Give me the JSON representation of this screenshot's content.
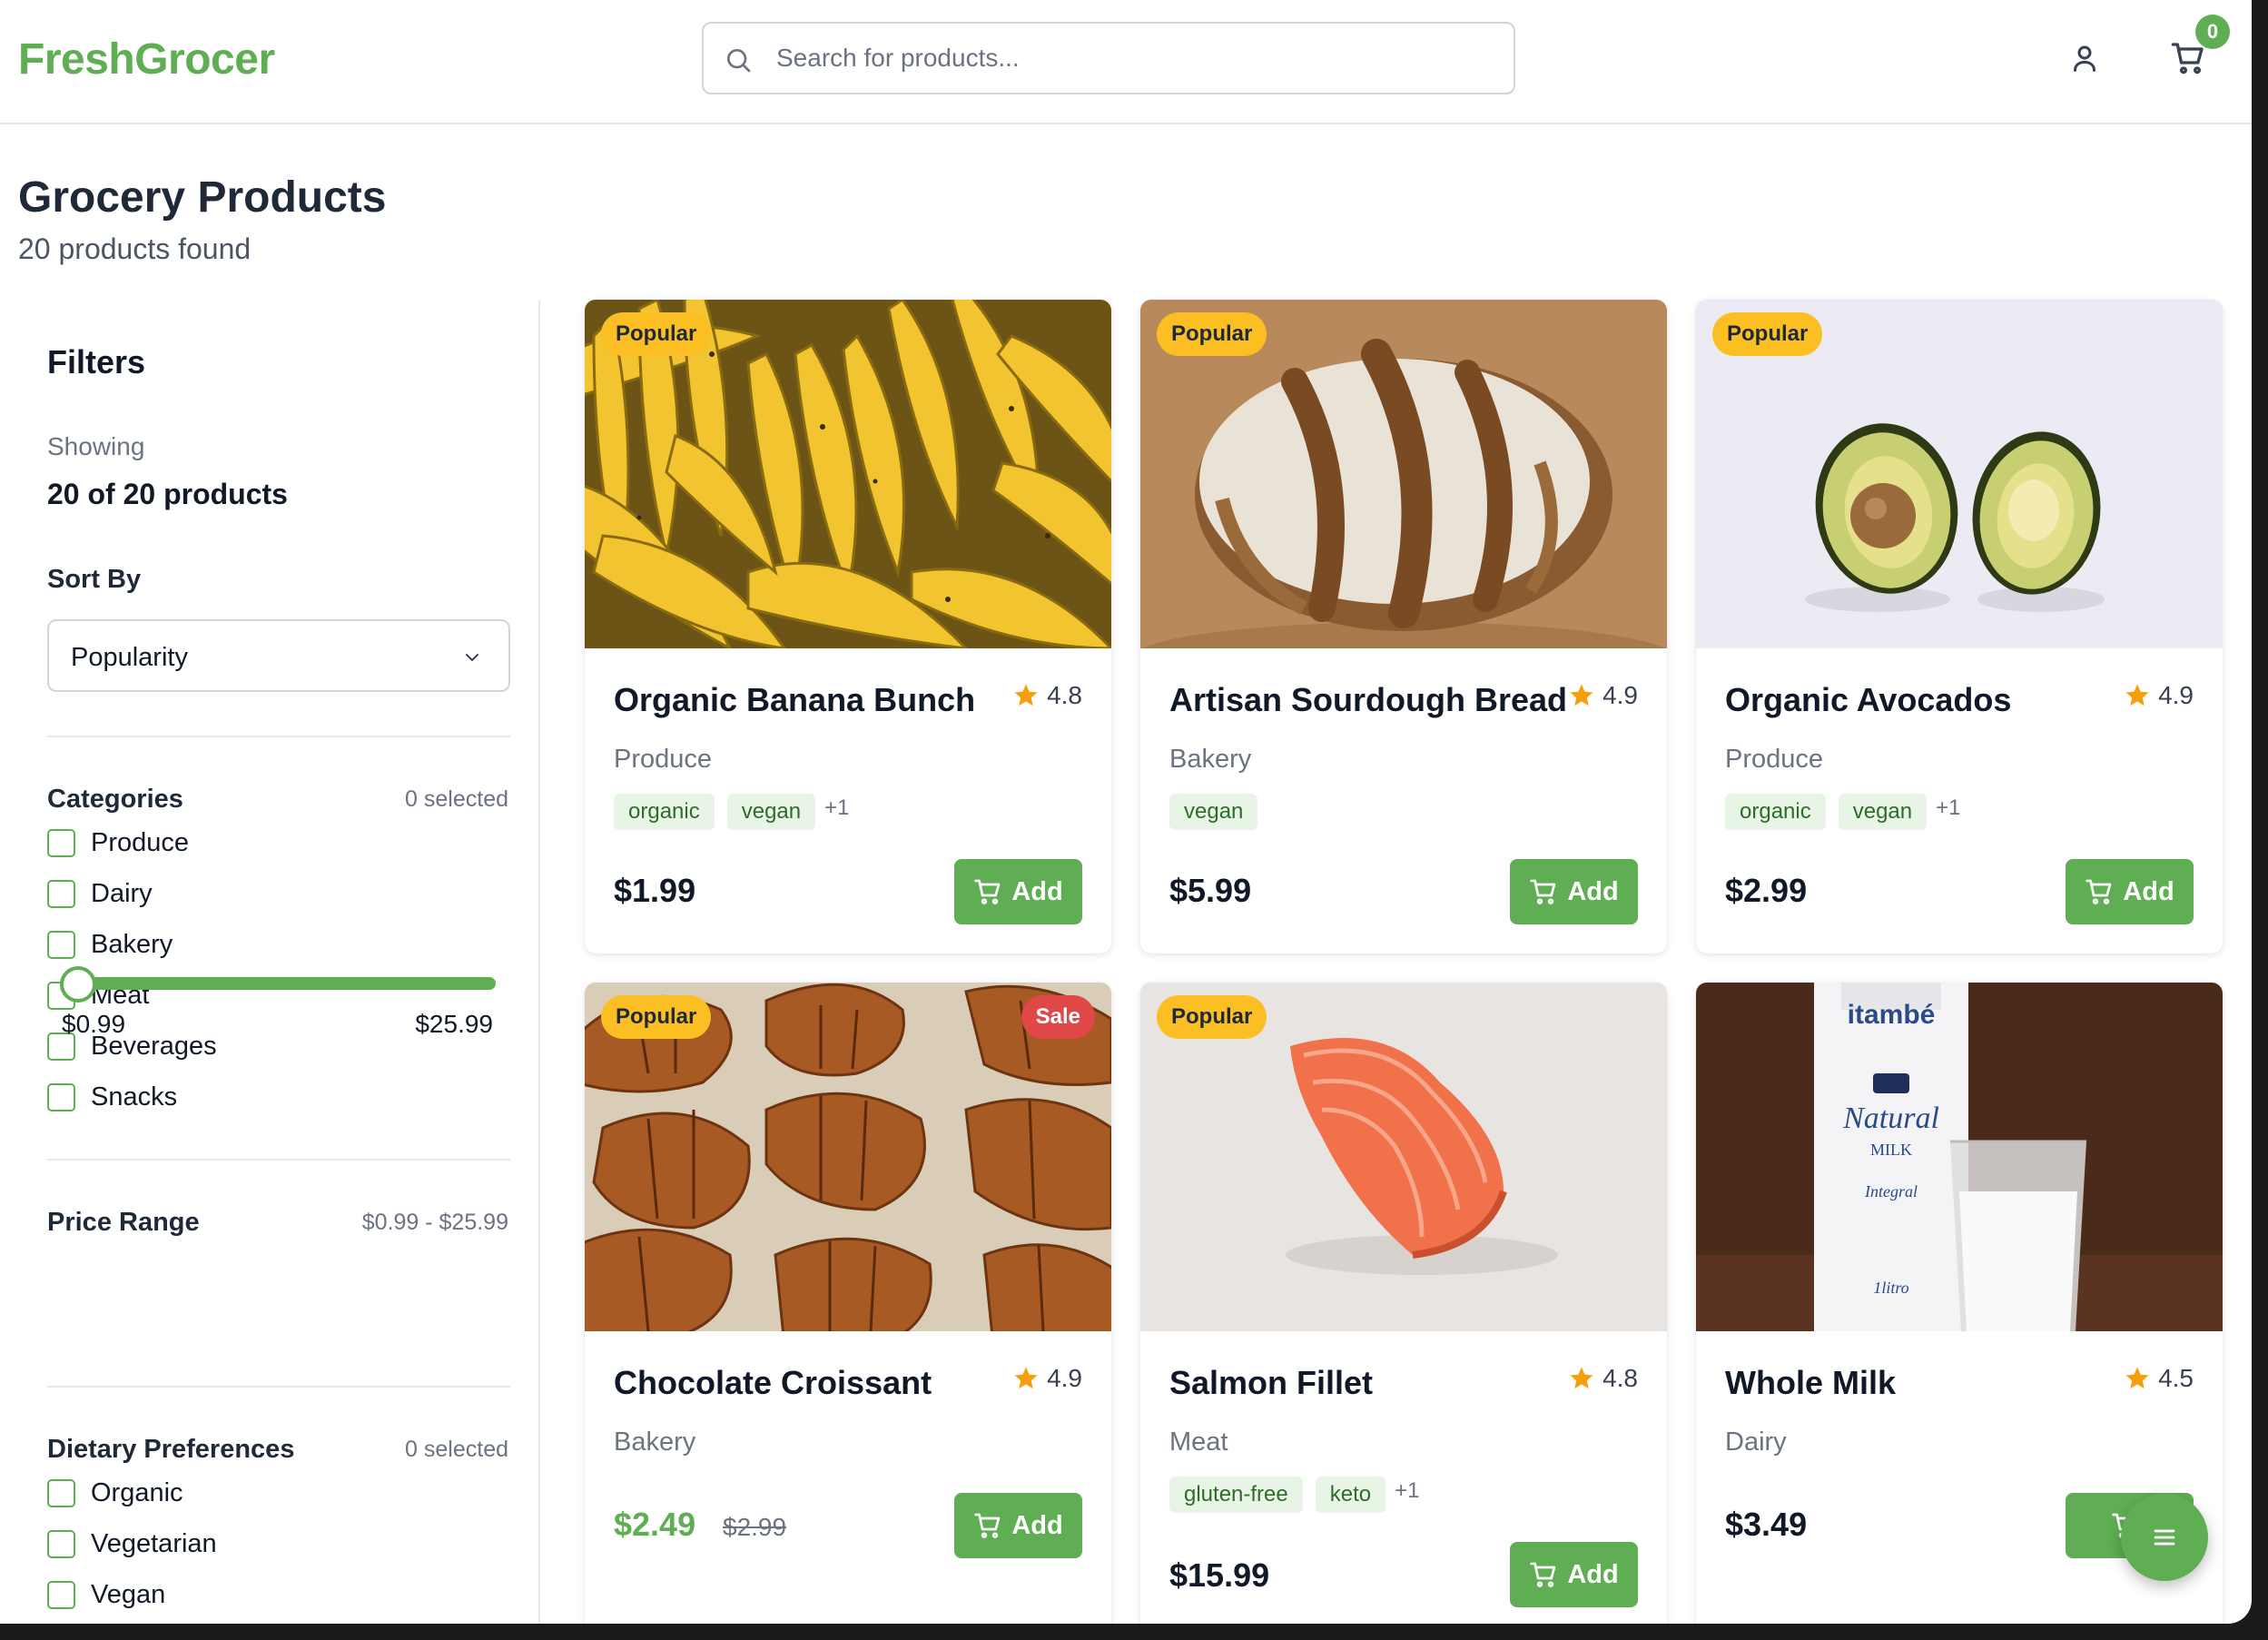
{
  "header": {
    "logo": "FreshGrocer",
    "search_placeholder": "Search for products...",
    "cart_count": "0"
  },
  "page": {
    "title": "Grocery Products",
    "count_text": "20 products found"
  },
  "sidebar": {
    "title": "Filters",
    "showing_label": "Showing",
    "showing_value": "20 of 20 products",
    "sort_label": "Sort By",
    "sort_value": "Popularity",
    "categories_title": "Categories",
    "categories_meta": "0 selected",
    "categories": [
      "Produce",
      "Dairy",
      "Bakery",
      "Meat",
      "Beverages",
      "Snacks"
    ],
    "price_title": "Price Range",
    "price_meta": "$0.99 - $25.99",
    "price_min": "$0.99",
    "price_max": "$25.99",
    "dietary_title": "Dietary Preferences",
    "dietary_meta": "0 selected",
    "dietary": [
      "Organic",
      "Vegetarian",
      "Vegan"
    ]
  },
  "products": [
    {
      "name": "Organic Banana Bunch",
      "rating": "4.8",
      "category": "Produce",
      "tags": [
        "organic",
        "vegan"
      ],
      "more": "+1",
      "price": "$1.99",
      "old_price": "",
      "badges": [
        "Popular"
      ],
      "add_label": "Add",
      "image": "bananas"
    },
    {
      "name": "Artisan Sourdough Bread",
      "rating": "4.9",
      "category": "Bakery",
      "tags": [
        "vegan"
      ],
      "more": "",
      "price": "$5.99",
      "old_price": "",
      "badges": [
        "Popular"
      ],
      "add_label": "Add",
      "image": "bread"
    },
    {
      "name": "Organic Avocados",
      "rating": "4.9",
      "category": "Produce",
      "tags": [
        "organic",
        "vegan"
      ],
      "more": "+1",
      "price": "$2.99",
      "old_price": "",
      "badges": [
        "Popular"
      ],
      "add_label": "Add",
      "image": "avocados"
    },
    {
      "name": "Chocolate Croissant",
      "rating": "4.9",
      "category": "Bakery",
      "tags": [],
      "more": "",
      "price": "$2.49",
      "old_price": "$2.99",
      "badges": [
        "Popular",
        "Sale"
      ],
      "add_label": "Add",
      "image": "croissants"
    },
    {
      "name": "Salmon Fillet",
      "rating": "4.8",
      "category": "Meat",
      "tags": [
        "gluten-free",
        "keto"
      ],
      "more": "+1",
      "price": "$15.99",
      "old_price": "",
      "badges": [
        "Popular"
      ],
      "add_label": "Add",
      "image": "salmon"
    },
    {
      "name": "Whole Milk",
      "rating": "4.5",
      "category": "Dairy",
      "tags": [],
      "more": "",
      "price": "$3.49",
      "old_price": "",
      "badges": [],
      "add_label": "",
      "image": "milk",
      "milk_label": {
        "brand": "itambé",
        "name": "Natural",
        "type": "MILK",
        "variant": "Integral",
        "volume": "1litro"
      }
    }
  ]
}
